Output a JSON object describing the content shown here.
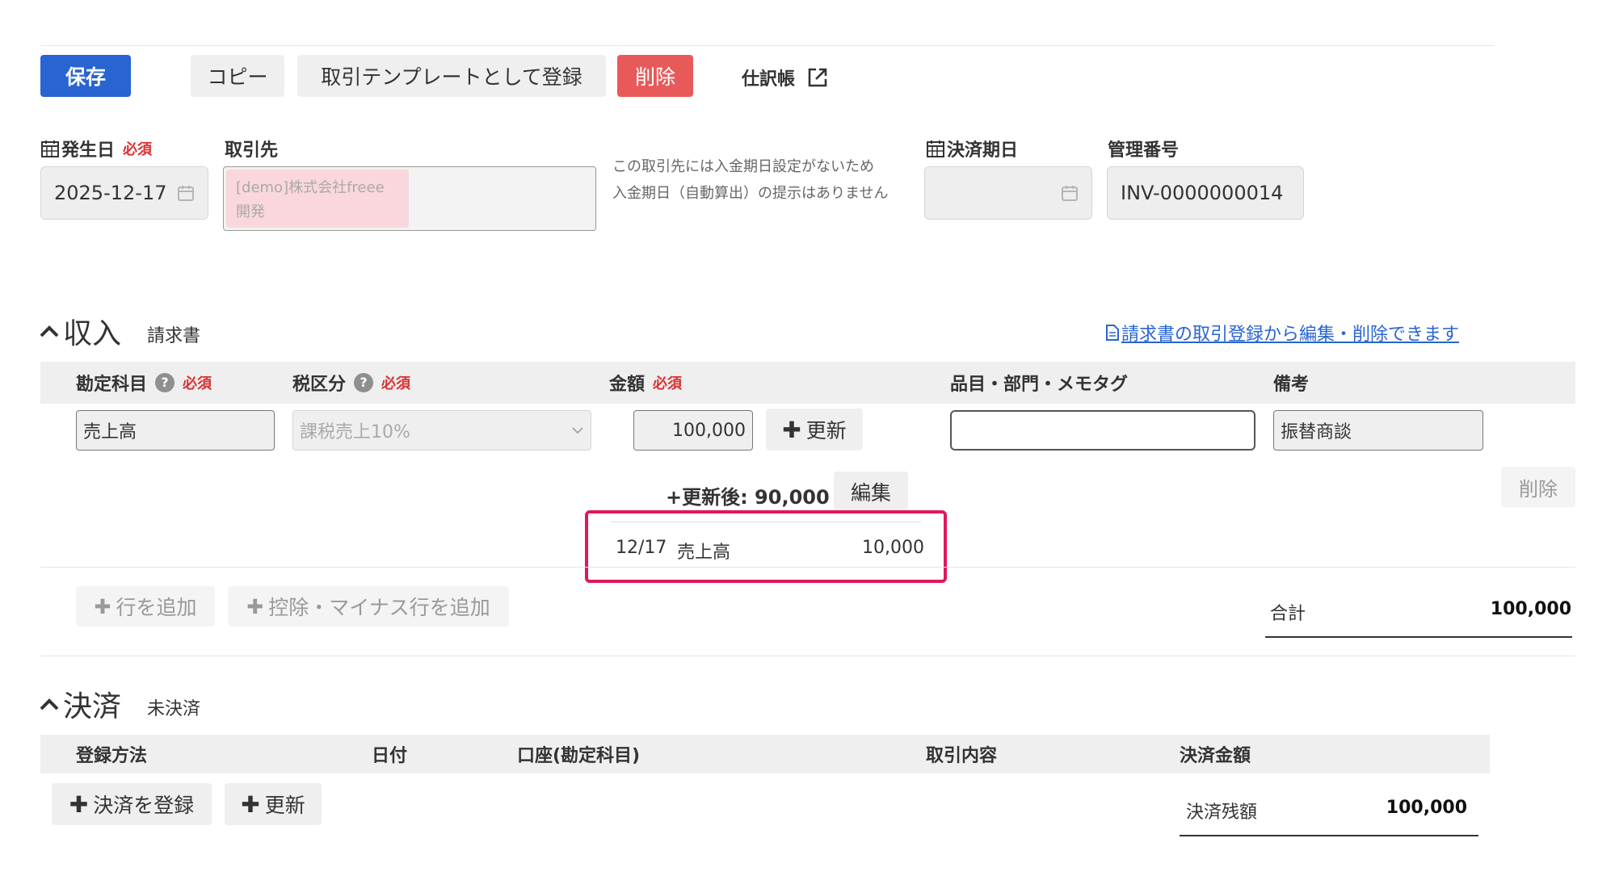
{
  "toolbar": {
    "save": "保存",
    "copy": "コピー",
    "register_template": "取引テンプレートとして登録",
    "delete": "削除",
    "journal": "仕訳帳"
  },
  "form": {
    "issue_date_label": "発生日",
    "required": "必須",
    "issue_date_value": "2025-12-17",
    "partner_label": "取引先",
    "partner_tag_line1": "[demo]株式会社freee",
    "partner_tag_line2": "開発",
    "partner_note_line1": "この取引先には入金期日設定がないため",
    "partner_note_line2": "入金期日（自動算出）の提示はありません",
    "due_date_label": "決済期日",
    "due_date_value": "",
    "manage_no_label": "管理番号",
    "manage_no_value": "INV-0000000014"
  },
  "income": {
    "title": "収入",
    "subtitle": "請求書",
    "invoice_link": "請求書の取引登録から編集・削除できます",
    "headers": {
      "account": "勘定科目",
      "tax": "税区分",
      "amount": "金額",
      "items": "品目・部門・メモタグ",
      "memo": "備考",
      "required": "必須"
    },
    "row": {
      "account": "売上高",
      "tax": "課税売上10%",
      "amount": "100,000",
      "update_button": "更新",
      "items": "",
      "memo": "振替商談",
      "after_update": "+更新後: 90,000",
      "edit_button": "編集",
      "delete_button": "削除",
      "update_detail": {
        "date": "12/17",
        "account": "売上高",
        "amount": "10,000"
      }
    },
    "add_row": "行を追加",
    "add_minus_row": "控除・マイナス行を追加",
    "total_label": "合計",
    "total_value": "100,000"
  },
  "settlement": {
    "title": "決済",
    "subtitle": "未決済",
    "headers": {
      "method": "登録方法",
      "date": "日付",
      "account": "口座(勘定科目)",
      "content": "取引内容",
      "amount": "決済金額"
    },
    "register_button": "決済を登録",
    "update_button": "更新",
    "balance_label": "決済残額",
    "balance_value": "100,000"
  },
  "colors": {
    "primary": "#2864d2",
    "danger": "#e85a5a",
    "required": "#d93333",
    "highlight": "#e0185a",
    "partner_tag": "#f9d7dc"
  }
}
